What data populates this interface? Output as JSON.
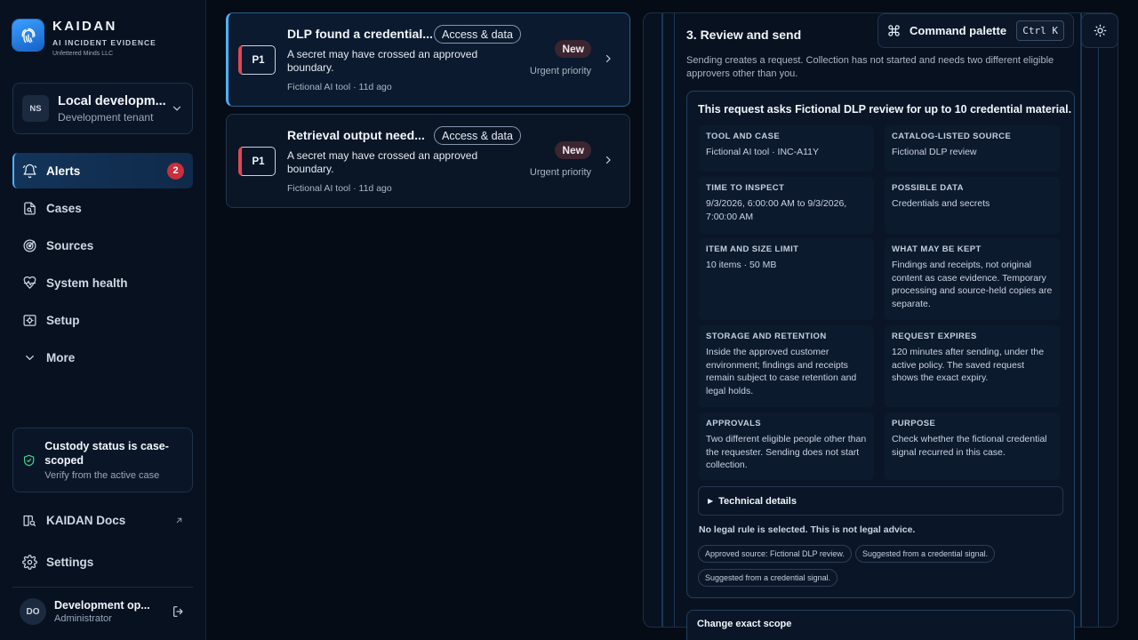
{
  "brand": {
    "name": "KAIDAN",
    "subtitle": "AI INCIDENT EVIDENCE",
    "org": "Unfettered Minds LLC"
  },
  "tenant": {
    "initials": "NS",
    "name": "Local developm...",
    "description": "Development tenant"
  },
  "nav": {
    "items": [
      {
        "label": "Alerts",
        "icon": "bell-icon",
        "badge": "2",
        "active": true
      },
      {
        "label": "Cases",
        "icon": "document-search-icon"
      },
      {
        "label": "Sources",
        "icon": "target-icon"
      },
      {
        "label": "System health",
        "icon": "heart-pulse-icon"
      },
      {
        "label": "Setup",
        "icon": "setup-icon"
      },
      {
        "label": "More",
        "icon": "chevron-down-icon"
      }
    ]
  },
  "custody": {
    "title": "Custody status is case-scoped",
    "description": "Verify from the active case"
  },
  "docs": {
    "label": "KAIDAN Docs"
  },
  "settings": {
    "label": "Settings"
  },
  "user": {
    "initials": "DO",
    "name": "Development op...",
    "role": "Administrator"
  },
  "alerts": [
    {
      "priority": "P1",
      "title": "DLP found a credential...",
      "category": "Access & data",
      "description": "A secret may have crossed an approved boundary.",
      "meta": "Fictional AI tool · 11d ago",
      "status": "New",
      "urgency": "Urgent priority"
    },
    {
      "priority": "P1",
      "title": "Retrieval output need...",
      "category": "Access & data",
      "description": "A secret may have crossed an approved boundary.",
      "meta": "Fictional AI tool · 11d ago",
      "status": "New",
      "urgency": "Urgent priority"
    }
  ],
  "topbar": {
    "command_palette": "Command palette",
    "shortcut": "Ctrl K"
  },
  "review": {
    "title": "3. Review and send",
    "description": "Sending creates a request. Collection has not started and needs two different eligible approvers other than you.",
    "request_heading": "This request asks Fictional DLP review for up to 10 credential material.",
    "fields": [
      {
        "label": "Tool and case",
        "value": "Fictional AI tool · INC-A11Y"
      },
      {
        "label": "Catalog-listed source",
        "value": "Fictional DLP review"
      },
      {
        "label": "Time to inspect",
        "value": "9/3/2026, 6:00:00 AM to 9/3/2026, 7:00:00 AM"
      },
      {
        "label": "Possible data",
        "value": "Credentials and secrets"
      },
      {
        "label": "Item and size limit",
        "value": "10 items · 50 MB"
      },
      {
        "label": "What may be kept",
        "value": "Findings and receipts, not original content as case evidence. Temporary processing and source-held copies are separate."
      },
      {
        "label": "Storage and retention",
        "value": "Inside the approved customer environment; findings and receipts remain subject to case retention and legal holds."
      },
      {
        "label": "Request expires",
        "value": "120 minutes after sending, under the active policy. The saved request shows the exact expiry."
      },
      {
        "label": "Approvals",
        "value": "Two different eligible people other than the requester. Sending does not start collection."
      },
      {
        "label": "Purpose",
        "value": "Check whether the fictional credential signal recurred in this case."
      }
    ],
    "technical_details": "Technical details",
    "legal_note": "No legal rule is selected. This is not legal advice.",
    "chips": [
      "Approved source: Fictional DLP review.",
      "Suggested from a credential signal.",
      "Suggested from a credential signal."
    ],
    "change_scope": "Change exact scope"
  }
}
